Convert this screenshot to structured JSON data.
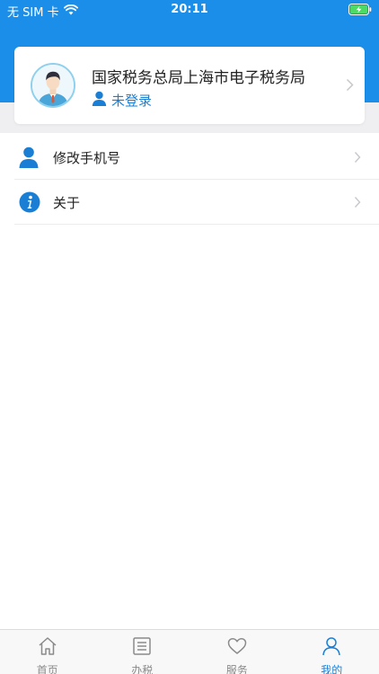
{
  "status_bar": {
    "carrier": "无 SIM 卡",
    "time": "20:11"
  },
  "profile": {
    "org_name": "国家税务总局上海市电子税务局",
    "login_status": "未登录"
  },
  "menu": [
    {
      "label": "修改手机号",
      "icon": "person-icon"
    },
    {
      "label": "关于",
      "icon": "info-icon"
    }
  ],
  "tabs": [
    {
      "label": "首页",
      "icon": "home-icon",
      "active": false
    },
    {
      "label": "办税",
      "icon": "list-icon",
      "active": false
    },
    {
      "label": "服务",
      "icon": "heart-icon",
      "active": false
    },
    {
      "label": "我的",
      "icon": "person-icon",
      "active": true
    }
  ],
  "colors": {
    "header_blue": "#1a8ee8",
    "accent": "#1a7fd4",
    "battery_green": "#4cd964"
  }
}
